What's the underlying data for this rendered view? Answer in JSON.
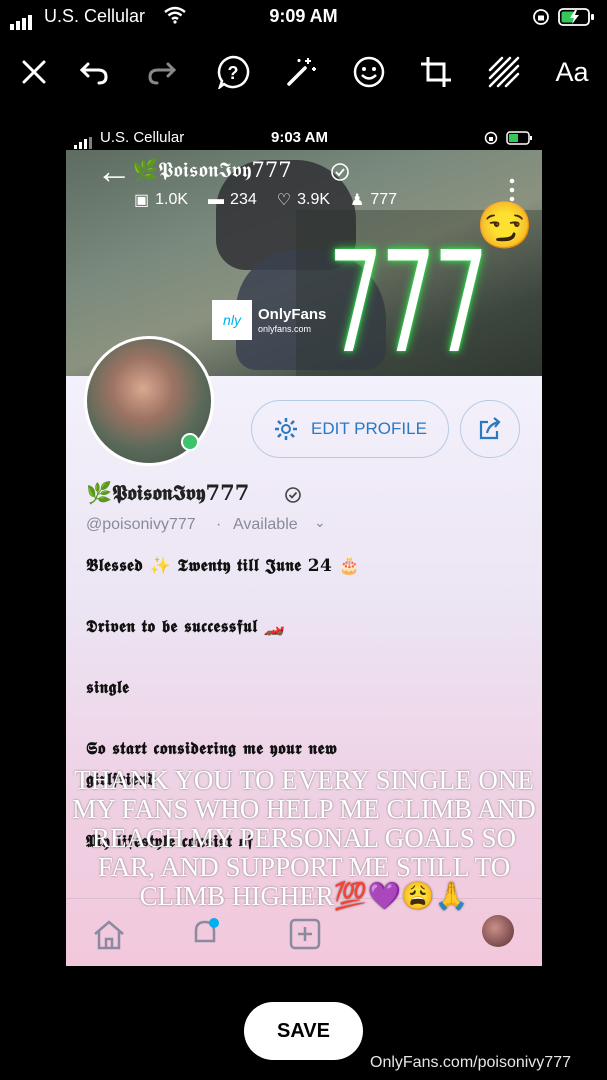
{
  "outer_status": {
    "carrier": "U.S. Cellular",
    "time": "9:09 AM"
  },
  "toolbar": {
    "tools": [
      {
        "icon": "close-icon"
      },
      {
        "icon": "undo-icon"
      },
      {
        "icon": "redo-icon"
      },
      {
        "icon": "help-icon"
      },
      {
        "icon": "magic-wand-icon"
      },
      {
        "icon": "emoji-icon"
      },
      {
        "icon": "crop-icon"
      },
      {
        "icon": "pattern-icon"
      }
    ],
    "text_tool_label": "Aa"
  },
  "inner_status": {
    "carrier": "U.S. Cellular",
    "time": "9:03 AM"
  },
  "banner": {
    "username": "🌿𝕻𝖔𝖎𝖘𝖔𝖓𝕴𝖛𝖞777",
    "stats": {
      "photos": "1.0K",
      "videos": "234",
      "likes": "3.9K",
      "fans": "777"
    },
    "big_number": "777",
    "onlyfans_brand": "OnlyFans",
    "onlyfans_url": "onlyfans.com",
    "emoji": "😏"
  },
  "profile": {
    "edit_label": "EDIT PROFILE",
    "display_name": "🌿𝕻𝖔𝖎𝖘𝖔𝖓𝕴𝖛𝖞777",
    "handle": "@poisonivy777",
    "availability": "Available",
    "bio": [
      "𝕭𝖑𝖊𝖘𝖘𝖊𝖉 ✨ 𝕿𝖜𝖊𝖓𝖙𝖞 𝖙𝖎𝖑𝖑 𝕵𝖚𝖓𝖊 24 🎂",
      "𝕯𝖗𝖎𝖛𝖊𝖓 𝖙𝖔 𝖇𝖊 𝖘𝖚𝖈𝖈𝖊𝖘𝖘𝖋𝖚𝖑 🏎️",
      "𝖘𝖎𝖓𝖌𝖑𝖊",
      "𝕾𝖔 𝖘𝖙𝖆𝖗𝖙 𝖈𝖔𝖓𝖘𝖎𝖉𝖊𝖗𝖎𝖓𝖌 𝖒𝖊 𝖞𝖔𝖚𝖗 𝖓𝖊𝖜",
      "𝖌𝖎𝖗𝖑𝖋𝖗𝖎𝖊𝖓𝖉",
      "𝕸𝖞 𝖑𝖎𝖋𝖊𝖘𝖙𝖞𝖑𝖊 𝖈𝖔𝖓𝖘𝖎𝖘𝖙 𝖔𝖋"
    ]
  },
  "overlay_text": "THANK YOU TO EVERY SINGLE ONE MY FANS WHO HELP ME CLIMB AND REACH MY PERSONAL GOALS SO FAR, AND SUPPORT ME STILL TO CLIMB HIGHER💯💜😩🙏",
  "save_label": "SAVE",
  "watermark": "OnlyFans.com/poisonivy777"
}
